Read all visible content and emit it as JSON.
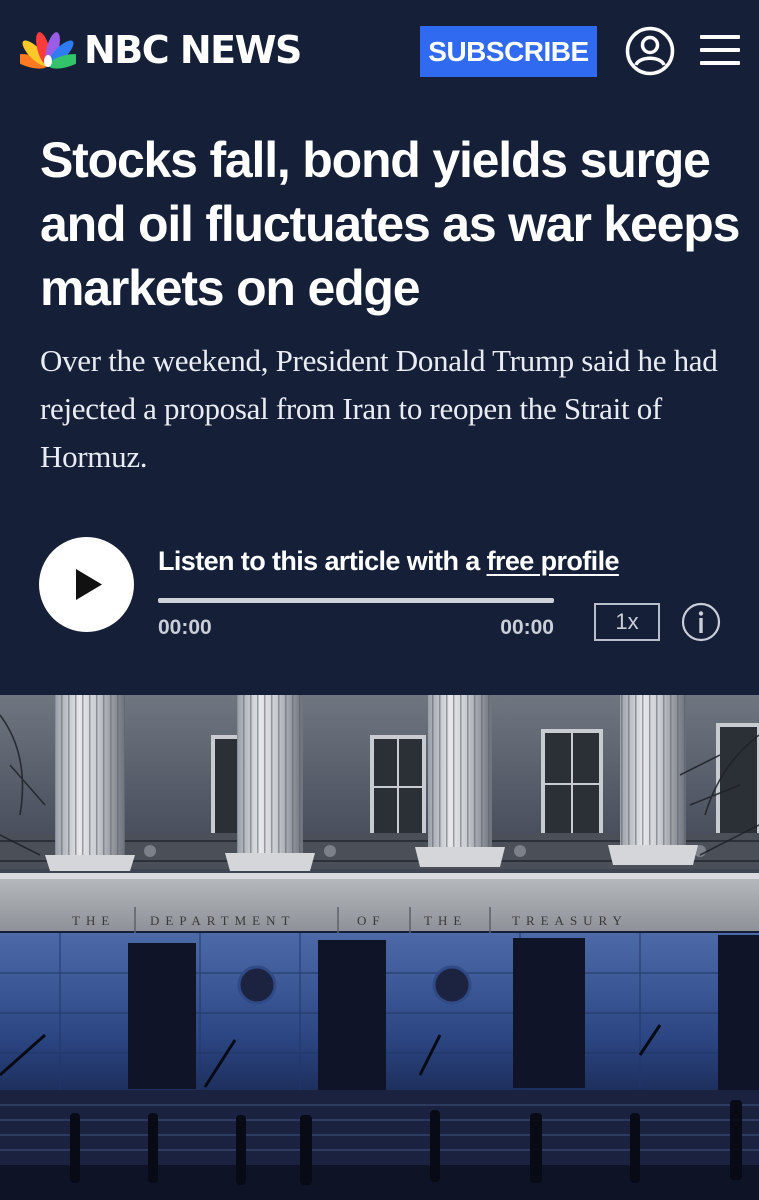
{
  "header": {
    "brand": "NBC NEWS",
    "subscribe_label": "SUBSCRIBE"
  },
  "article": {
    "headline": "Stocks fall, bond yields surge and oil fluctuates as war keeps markets on edge",
    "dek": "Over the weekend, President Donald Trump said he had rejected a proposal from Iran to reopen the Strait of Hormuz."
  },
  "audio_player": {
    "prompt_text": "Listen to this article with a ",
    "link_text": "free profile",
    "current_time": "00:00",
    "total_time": "00:00",
    "speed": "1x",
    "progress": 0
  },
  "hero_image": {
    "inscription_words": [
      "THE",
      "DEPARTMENT",
      "OF",
      "THE",
      "TREASURY"
    ]
  },
  "icons": {
    "logo": "peacock-icon",
    "account": "user-account-icon",
    "menu": "hamburger-menu-icon",
    "play": "play-icon",
    "info": "info-icon"
  },
  "colors": {
    "background": "#152038",
    "subscribe_button": "#2f6af0",
    "text": "#ffffff"
  }
}
